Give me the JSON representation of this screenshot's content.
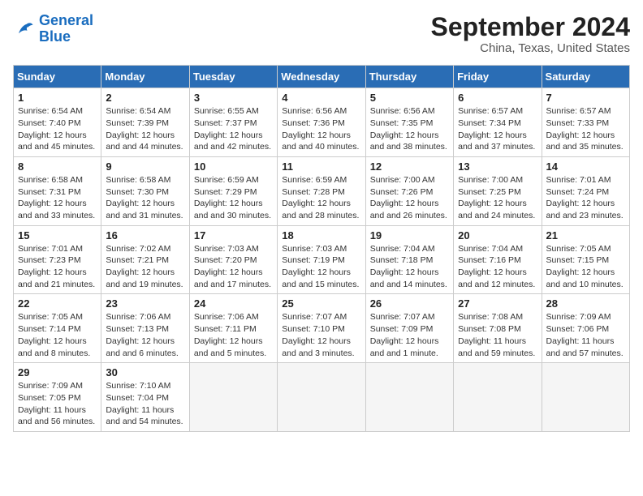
{
  "logo": {
    "text_general": "General",
    "text_blue": "Blue"
  },
  "header": {
    "month": "September 2024",
    "location": "China, Texas, United States"
  },
  "weekdays": [
    "Sunday",
    "Monday",
    "Tuesday",
    "Wednesday",
    "Thursday",
    "Friday",
    "Saturday"
  ],
  "weeks": [
    [
      {
        "day": "1",
        "sunrise": "6:54 AM",
        "sunset": "7:40 PM",
        "daylight": "12 hours and 45 minutes."
      },
      {
        "day": "2",
        "sunrise": "6:54 AM",
        "sunset": "7:39 PM",
        "daylight": "12 hours and 44 minutes."
      },
      {
        "day": "3",
        "sunrise": "6:55 AM",
        "sunset": "7:37 PM",
        "daylight": "12 hours and 42 minutes."
      },
      {
        "day": "4",
        "sunrise": "6:56 AM",
        "sunset": "7:36 PM",
        "daylight": "12 hours and 40 minutes."
      },
      {
        "day": "5",
        "sunrise": "6:56 AM",
        "sunset": "7:35 PM",
        "daylight": "12 hours and 38 minutes."
      },
      {
        "day": "6",
        "sunrise": "6:57 AM",
        "sunset": "7:34 PM",
        "daylight": "12 hours and 37 minutes."
      },
      {
        "day": "7",
        "sunrise": "6:57 AM",
        "sunset": "7:33 PM",
        "daylight": "12 hours and 35 minutes."
      }
    ],
    [
      {
        "day": "8",
        "sunrise": "6:58 AM",
        "sunset": "7:31 PM",
        "daylight": "12 hours and 33 minutes."
      },
      {
        "day": "9",
        "sunrise": "6:58 AM",
        "sunset": "7:30 PM",
        "daylight": "12 hours and 31 minutes."
      },
      {
        "day": "10",
        "sunrise": "6:59 AM",
        "sunset": "7:29 PM",
        "daylight": "12 hours and 30 minutes."
      },
      {
        "day": "11",
        "sunrise": "6:59 AM",
        "sunset": "7:28 PM",
        "daylight": "12 hours and 28 minutes."
      },
      {
        "day": "12",
        "sunrise": "7:00 AM",
        "sunset": "7:26 PM",
        "daylight": "12 hours and 26 minutes."
      },
      {
        "day": "13",
        "sunrise": "7:00 AM",
        "sunset": "7:25 PM",
        "daylight": "12 hours and 24 minutes."
      },
      {
        "day": "14",
        "sunrise": "7:01 AM",
        "sunset": "7:24 PM",
        "daylight": "12 hours and 23 minutes."
      }
    ],
    [
      {
        "day": "15",
        "sunrise": "7:01 AM",
        "sunset": "7:23 PM",
        "daylight": "12 hours and 21 minutes."
      },
      {
        "day": "16",
        "sunrise": "7:02 AM",
        "sunset": "7:21 PM",
        "daylight": "12 hours and 19 minutes."
      },
      {
        "day": "17",
        "sunrise": "7:03 AM",
        "sunset": "7:20 PM",
        "daylight": "12 hours and 17 minutes."
      },
      {
        "day": "18",
        "sunrise": "7:03 AM",
        "sunset": "7:19 PM",
        "daylight": "12 hours and 15 minutes."
      },
      {
        "day": "19",
        "sunrise": "7:04 AM",
        "sunset": "7:18 PM",
        "daylight": "12 hours and 14 minutes."
      },
      {
        "day": "20",
        "sunrise": "7:04 AM",
        "sunset": "7:16 PM",
        "daylight": "12 hours and 12 minutes."
      },
      {
        "day": "21",
        "sunrise": "7:05 AM",
        "sunset": "7:15 PM",
        "daylight": "12 hours and 10 minutes."
      }
    ],
    [
      {
        "day": "22",
        "sunrise": "7:05 AM",
        "sunset": "7:14 PM",
        "daylight": "12 hours and 8 minutes."
      },
      {
        "day": "23",
        "sunrise": "7:06 AM",
        "sunset": "7:13 PM",
        "daylight": "12 hours and 6 minutes."
      },
      {
        "day": "24",
        "sunrise": "7:06 AM",
        "sunset": "7:11 PM",
        "daylight": "12 hours and 5 minutes."
      },
      {
        "day": "25",
        "sunrise": "7:07 AM",
        "sunset": "7:10 PM",
        "daylight": "12 hours and 3 minutes."
      },
      {
        "day": "26",
        "sunrise": "7:07 AM",
        "sunset": "7:09 PM",
        "daylight": "12 hours and 1 minute."
      },
      {
        "day": "27",
        "sunrise": "7:08 AM",
        "sunset": "7:08 PM",
        "daylight": "11 hours and 59 minutes."
      },
      {
        "day": "28",
        "sunrise": "7:09 AM",
        "sunset": "7:06 PM",
        "daylight": "11 hours and 57 minutes."
      }
    ],
    [
      {
        "day": "29",
        "sunrise": "7:09 AM",
        "sunset": "7:05 PM",
        "daylight": "11 hours and 56 minutes."
      },
      {
        "day": "30",
        "sunrise": "7:10 AM",
        "sunset": "7:04 PM",
        "daylight": "11 hours and 54 minutes."
      },
      {
        "day": "",
        "sunrise": "",
        "sunset": "",
        "daylight": ""
      },
      {
        "day": "",
        "sunrise": "",
        "sunset": "",
        "daylight": ""
      },
      {
        "day": "",
        "sunrise": "",
        "sunset": "",
        "daylight": ""
      },
      {
        "day": "",
        "sunrise": "",
        "sunset": "",
        "daylight": ""
      },
      {
        "day": "",
        "sunrise": "",
        "sunset": "",
        "daylight": ""
      }
    ]
  ],
  "labels": {
    "sunrise": "Sunrise:",
    "sunset": "Sunset:",
    "daylight": "Daylight:"
  }
}
